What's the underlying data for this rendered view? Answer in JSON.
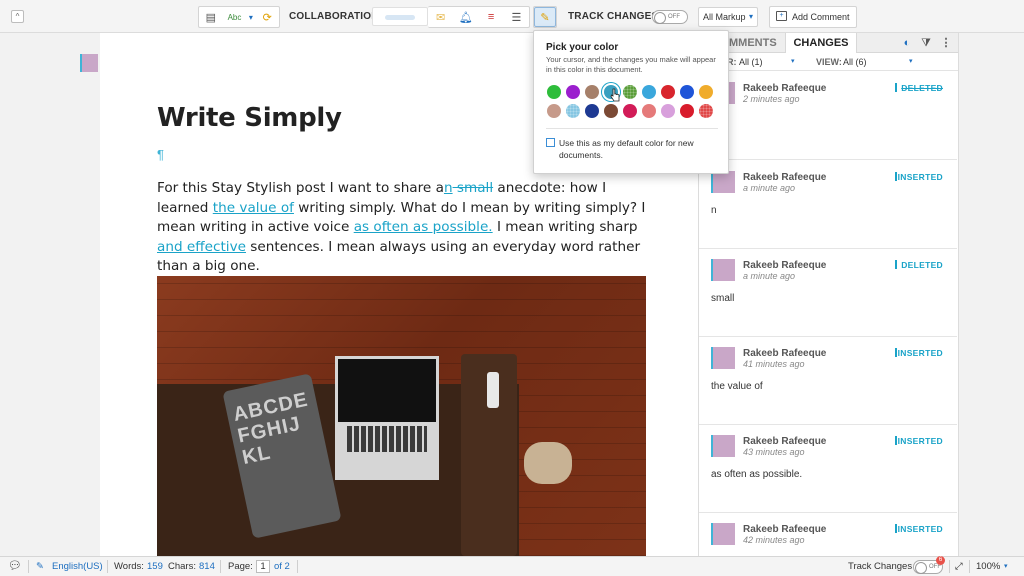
{
  "toolbar": {
    "collaboration_label": "COLLABORATION:",
    "track_changes_label": "TRACK CHANGES:",
    "track_toggle_state": "OFF",
    "markup_select": "All Markup",
    "add_comment": "Add Comment",
    "collapse_glyph": "^",
    "spell_label": "Abc"
  },
  "document": {
    "title": "Write Simply",
    "paragraph_mark": "¶",
    "body": {
      "p1": "For this Stay Stylish post I want to share a",
      "ins_n": "n",
      "del_small": " small",
      "p2": " anecdote: how I learned",
      "ins_value": "the value of",
      "p3": " writing simply. What do I mean by writing simply? I mean writing in active voice ",
      "ins_often": "as often as possible.",
      "p4": " I mean writing sharp ",
      "ins_effective": "and effective",
      "p5": " sentences. I mean always using an everyday word rather than a big one."
    },
    "image_pillow_text": "ABCDE FGHIJ KL"
  },
  "panel": {
    "tab_comments": "MMENTS",
    "tab_changes": "CHANGES",
    "filter_label": "R:",
    "filter_value": "All (1)",
    "view_label": "VIEW:",
    "view_value": "All (6)",
    "changes": [
      {
        "author": "Rakeeb Rafeeque",
        "time": "2 minutes ago",
        "type": "DELETED",
        "text": ""
      },
      {
        "author": "Rakeeb Rafeeque",
        "time": "a minute ago",
        "type": "INSERTED",
        "text": "n"
      },
      {
        "author": "Rakeeb Rafeeque",
        "time": "a minute ago",
        "type": "DELETED",
        "text": "small"
      },
      {
        "author": "Rakeeb Rafeeque",
        "time": "41 minutes ago",
        "type": "INSERTED",
        "text": "the value of"
      },
      {
        "author": "Rakeeb Rafeeque",
        "time": "43 minutes ago",
        "type": "INSERTED",
        "text": "as often as possible."
      },
      {
        "author": "Rakeeb Rafeeque",
        "time": "42 minutes ago",
        "type": "INSERTED",
        "text": ""
      }
    ]
  },
  "color_popup": {
    "title": "Pick your color",
    "description": "Your cursor, and the changes you make will appear in this color in this document.",
    "swatches": [
      "#2ebd3b",
      "#9b1fce",
      "#a6806a",
      "#3aa0c0",
      "#5b9e3a",
      "#3aa7dc",
      "#d8252d",
      "#1f55d8",
      "#f0ac2c",
      "#c69a8a",
      "#86c6e2",
      "#1e3a93",
      "#7b4a35",
      "#d21c58",
      "#e57a7a",
      "#d8a0dc",
      "#d81c2c",
      "#e04848"
    ],
    "selected_index": 3,
    "default_label": "Use this as my default color for new documents."
  },
  "statusbar": {
    "language": "English(US)",
    "words_label": "Words:",
    "words": "159",
    "chars_label": "Chars:",
    "chars": "814",
    "page_label": "Page:",
    "page_current": "1",
    "page_total": "of 2",
    "track_changes": "Track Changes",
    "track_state": "OFF",
    "badge": "6",
    "zoom": "100%"
  }
}
